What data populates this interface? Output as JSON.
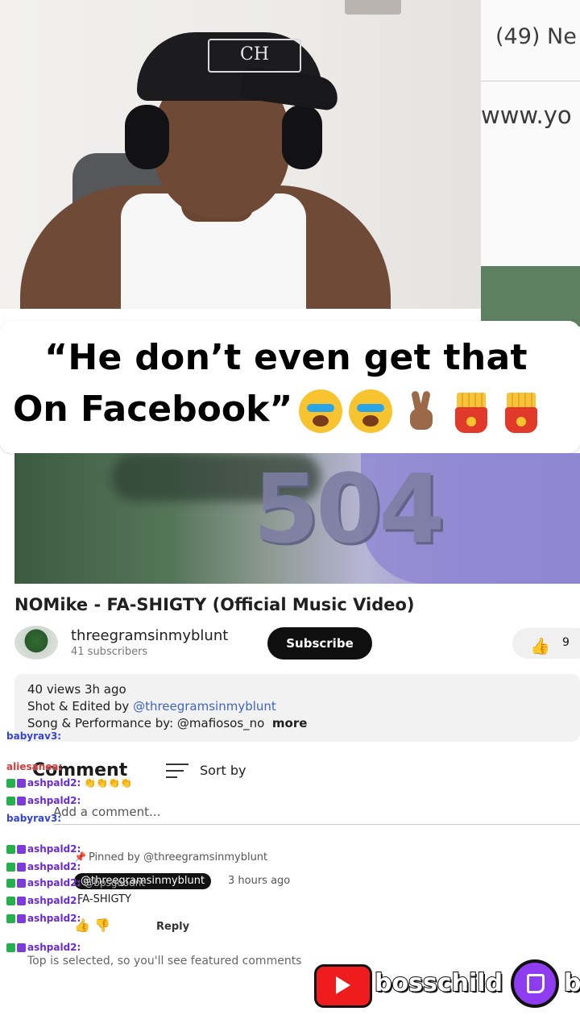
{
  "browser": {
    "tab_text": "(49) Ne",
    "url_text": "www.yo"
  },
  "cap_logo": "CH",
  "caption": {
    "line1": "“He don’t even get that",
    "line2": "On Facebook”"
  },
  "video": {
    "thumb_text": "504",
    "title": "NOMike - FA-SHIGTY (Official Music Video)",
    "channel": "threegramsinmyblunt",
    "subscribers": "41 subscribers",
    "subscribe_label": "Subscribe",
    "like_count": "9",
    "desc_views": "40 views  3h ago",
    "desc_shot_prefix": "Shot & Edited by ",
    "desc_shot_link": "@threegramsinmyblunt",
    "desc_song": "Song & Performance by: @mafiosos_no",
    "desc_more": "more"
  },
  "comments": {
    "header": "Comment",
    "sort_label": "Sort by",
    "add_placeholder": "Add a comment...",
    "pinned": "Pinned by @threegramsinmyblunt",
    "author": "@threegramsinmyblunt",
    "time": "3 hours ago",
    "text": "FA-SHIGTY",
    "reply": "Reply",
    "top_notice": "Top is selected, so you'll see featured comments"
  },
  "chat": [
    {
      "name": "babyrav3:",
      "color": "blue",
      "badges": 0
    },
    {
      "name": "aliesanea:",
      "color": "red",
      "badges": 0
    },
    {
      "name": "ashpald2:",
      "color": "purple",
      "badges": 2,
      "msg": "👏👏👏👏"
    },
    {
      "name": "ashpald2:",
      "color": "purple",
      "badges": 2
    },
    {
      "name": "babyrav3:",
      "color": "blue",
      "badges": 0
    },
    {
      "name": "ashpald2:",
      "color": "purple",
      "badges": 2
    },
    {
      "name": "ashpald2:",
      "color": "purple",
      "badges": 2
    },
    {
      "name": "ashpald2:",
      "color": "purple",
      "badges": 2,
      "msg": "@bpsgoodnt"
    },
    {
      "name": "ashpald2:",
      "color": "purple",
      "badges": 2
    },
    {
      "name": "ashpald2:",
      "color": "purple",
      "badges": 2
    },
    {
      "name": "ashpald2:",
      "color": "purple",
      "badges": 2
    }
  ],
  "social": {
    "handle": "bosschild",
    "handle2": "b"
  },
  "colors": {
    "subscribe_bg": "#0f0f0f",
    "twitch": "#8e3cf0",
    "youtube": "#ee1c1c",
    "link": "#3e64c6"
  }
}
